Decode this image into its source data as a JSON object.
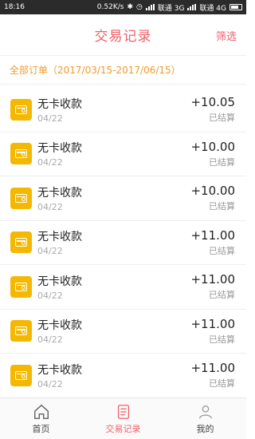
{
  "status_bar": {
    "time": "18:16",
    "speed": "0.52K/s",
    "carrier1": "联通 3G",
    "carrier2": "联通 4G"
  },
  "header": {
    "title": "交易记录",
    "filter_label": "筛选"
  },
  "range_label": "全部订单（2017/03/15-2017/06/15）",
  "transactions": [
    {
      "name": "无卡收款",
      "date": "04/22",
      "amount": "+10.05",
      "status": "已结算"
    },
    {
      "name": "无卡收款",
      "date": "04/22",
      "amount": "+10.00",
      "status": "已结算"
    },
    {
      "name": "无卡收款",
      "date": "04/22",
      "amount": "+10.00",
      "status": "已结算"
    },
    {
      "name": "无卡收款",
      "date": "04/22",
      "amount": "+11.00",
      "status": "已结算"
    },
    {
      "name": "无卡收款",
      "date": "04/22",
      "amount": "+11.00",
      "status": "已结算"
    },
    {
      "name": "无卡收款",
      "date": "04/22",
      "amount": "+11.00",
      "status": "已结算"
    },
    {
      "name": "无卡收款",
      "date": "04/22",
      "amount": "+11.00",
      "status": "已结算"
    }
  ],
  "tabbar": {
    "home_label": "首页",
    "records_label": "交易记录",
    "mine_label": "我的",
    "active_color": "#f0606a"
  },
  "colors": {
    "accent": "#f0606a",
    "range_text": "#f29a2e",
    "icon_bg": "#f5b800"
  }
}
